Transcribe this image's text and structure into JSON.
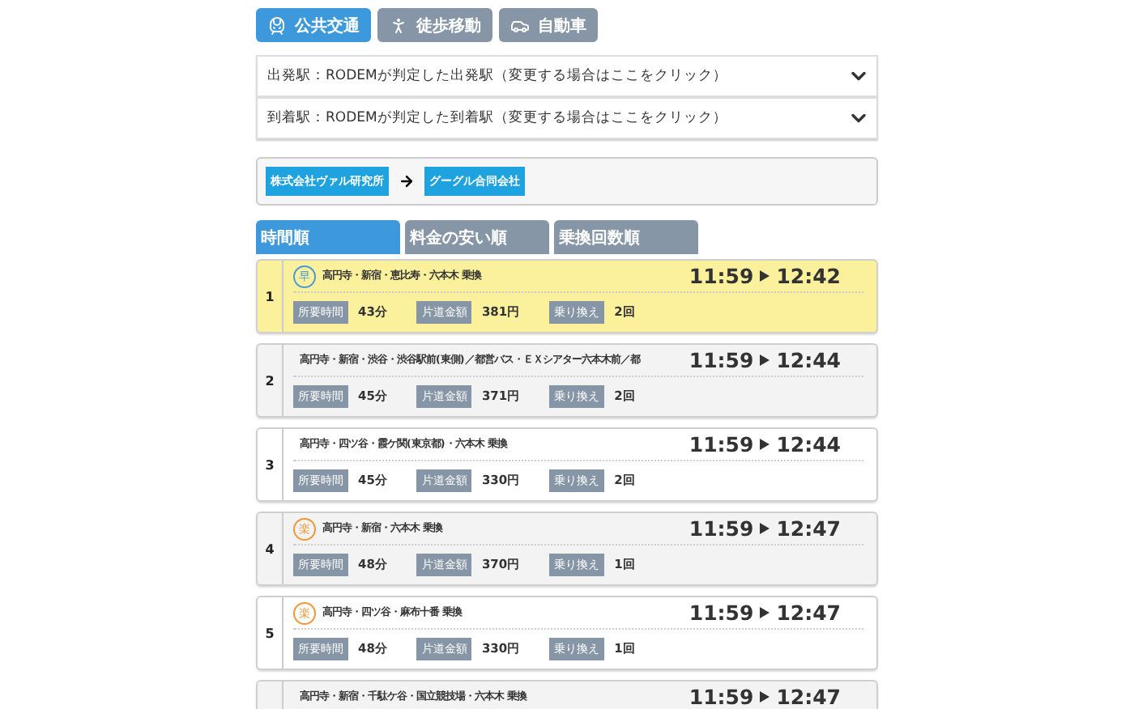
{
  "modes": [
    {
      "label": "公共交通",
      "kind": "train",
      "selected": true
    },
    {
      "label": "徒歩移動",
      "kind": "walk",
      "selected": false
    },
    {
      "label": "自動車",
      "kind": "car",
      "selected": false
    }
  ],
  "stations": [
    {
      "text": "出発駅：RODEMが判定した出発駅（変更する場合はここをクリック）"
    },
    {
      "text": "到着駅：RODEMが判定した到着駅（変更する場合はここをクリック）"
    }
  ],
  "route": {
    "from": "株式会社ヴァル研究所",
    "to": "グーグル合同会社"
  },
  "sort_tabs": [
    {
      "label": "時間順",
      "selected": true
    },
    {
      "label": "料金の安い順",
      "selected": false
    },
    {
      "label": "乗換回数順",
      "selected": false
    }
  ],
  "results": [
    {
      "number": "1",
      "selected": true,
      "badge": {
        "text": "早",
        "color": "#4a9ad8"
      },
      "route": "高円寺・新宿・恵比寿・六本木 乗換",
      "depart": "11:59",
      "arrive": "12:42",
      "duration_label": "所要時間",
      "duration": "43分",
      "fare_label": "片道金額",
      "fare": "381円",
      "transfer_label": "乗り換え",
      "transfers": "2回"
    },
    {
      "number": "2",
      "selected": false,
      "route": "高円寺・新宿・渋谷・渋谷駅前(東側)／都営バス・ＥＸシアター六本木前／都",
      "depart": "11:59",
      "arrive": "12:44",
      "duration_label": "所要時間",
      "duration": "45分",
      "fare_label": "片道金額",
      "fare": "371円",
      "transfer_label": "乗り換え",
      "transfers": "2回"
    },
    {
      "number": "3",
      "selected": false,
      "route": "高円寺・四ツ谷・霞ケ関(東京都)・六本木 乗換",
      "depart": "11:59",
      "arrive": "12:44",
      "duration_label": "所要時間",
      "duration": "45分",
      "fare_label": "片道金額",
      "fare": "330円",
      "transfer_label": "乗り換え",
      "transfers": "2回"
    },
    {
      "number": "4",
      "selected": false,
      "badge": {
        "text": "楽",
        "color": "#f0973a"
      },
      "route": "高円寺・新宿・六本木 乗換",
      "depart": "11:59",
      "arrive": "12:47",
      "duration_label": "所要時間",
      "duration": "48分",
      "fare_label": "片道金額",
      "fare": "370円",
      "transfer_label": "乗り換え",
      "transfers": "1回"
    },
    {
      "number": "5",
      "selected": false,
      "badge": {
        "text": "楽",
        "color": "#f0973a"
      },
      "route": "高円寺・四ツ谷・麻布十番 乗換",
      "depart": "11:59",
      "arrive": "12:47",
      "duration_label": "所要時間",
      "duration": "48分",
      "fare_label": "片道金額",
      "fare": "330円",
      "transfer_label": "乗り換え",
      "transfers": "1回"
    },
    {
      "selected": false,
      "route": "高円寺・新宿・千駄ケ谷・国立競技場・六本木 乗換",
      "depart": "11:59",
      "arrive": "12:47"
    }
  ]
}
